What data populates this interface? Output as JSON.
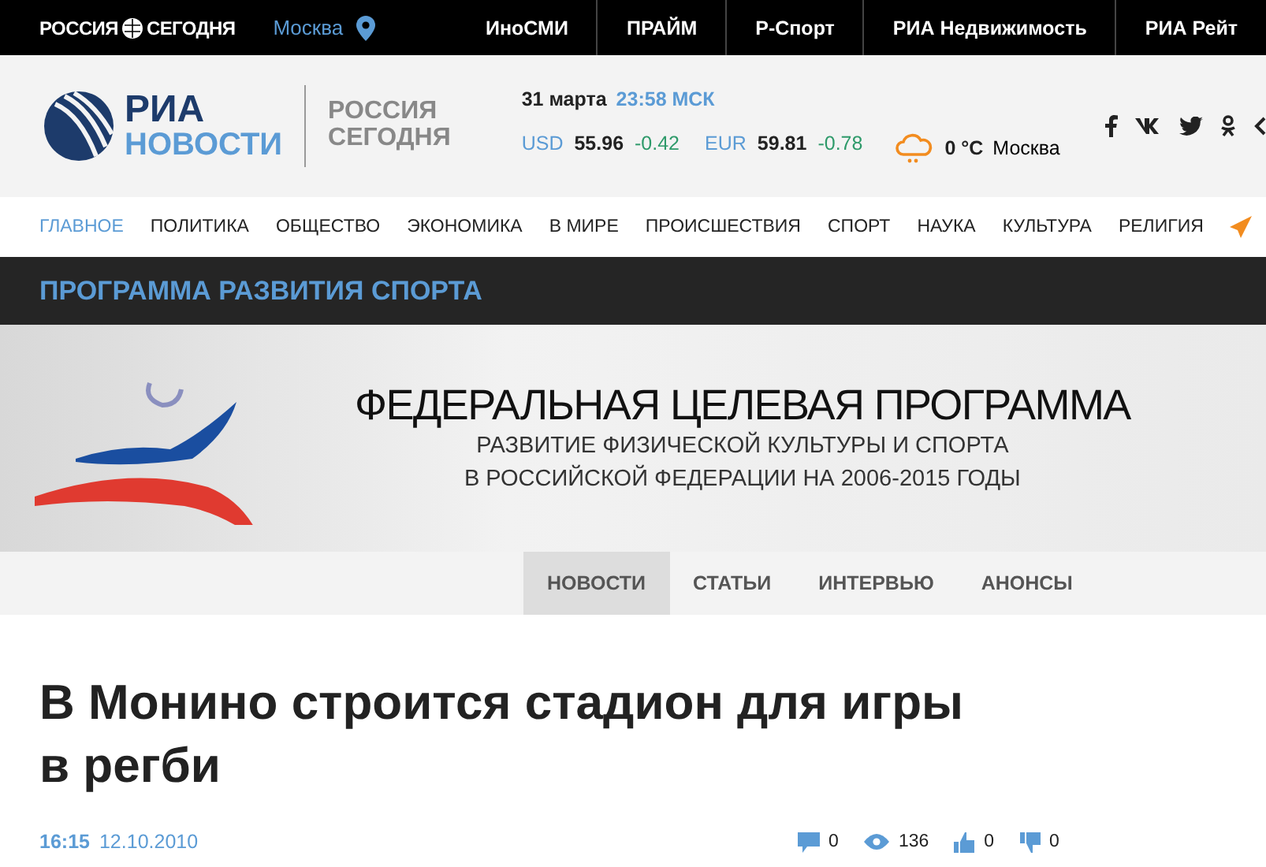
{
  "topbar": {
    "brand_left": "РОССИЯ",
    "brand_right": "СЕГОДНЯ",
    "city": "Москва",
    "links": [
      "ИноСМИ",
      "ПРАЙМ",
      "Р-Спорт",
      "РИА Недвижимость",
      "РИА Рейт"
    ]
  },
  "header": {
    "logo_top": "РИА",
    "logo_bottom": "НОВОСТИ",
    "partner_top": "РОССИЯ",
    "partner_bottom": "СЕГОДНЯ",
    "date": "31 марта",
    "time": "23:58 МСК",
    "rates": [
      {
        "code": "USD",
        "value": "55.96",
        "change": "-0.42"
      },
      {
        "code": "EUR",
        "value": "59.81",
        "change": "-0.78"
      }
    ],
    "weather": {
      "temp": "0 °C",
      "city": "Москва"
    }
  },
  "nav": [
    {
      "label": "ГЛАВНОЕ",
      "selected": true
    },
    {
      "label": "ПОЛИТИКА",
      "selected": false
    },
    {
      "label": "ОБЩЕСТВО",
      "selected": false
    },
    {
      "label": "ЭКОНОМИКА",
      "selected": false
    },
    {
      "label": "В МИРЕ",
      "selected": false
    },
    {
      "label": "ПРОИСШЕСТВИЯ",
      "selected": false
    },
    {
      "label": "СПОРТ",
      "selected": false
    },
    {
      "label": "НАУКА",
      "selected": false
    },
    {
      "label": "КУЛЬТУРА",
      "selected": false
    },
    {
      "label": "РЕЛИГИЯ",
      "selected": false
    }
  ],
  "section_title": "ПРОГРАММА РАЗВИТИЯ СПОРТА",
  "banner": {
    "title": "ФЕДЕРАЛЬНАЯ ЦЕЛЕВАЯ ПРОГРАММА",
    "subtitle_1": "РАЗВИТИЕ ФИЗИЧЕСКОЙ КУЛЬТУРЫ И СПОРТА",
    "subtitle_2": "В РОССИЙСКОЙ ФЕДЕРАЦИИ НА 2006-2015 ГОДЫ"
  },
  "subnav": [
    {
      "label": "НОВОСТИ",
      "selected": true
    },
    {
      "label": "СТАТЬИ",
      "selected": false
    },
    {
      "label": "ИНТЕРВЬЮ",
      "selected": false
    },
    {
      "label": "АНОНСЫ",
      "selected": false
    }
  ],
  "article": {
    "headline": "В Монино строится стадион для игры в регби",
    "time": "16:15",
    "date": "12.10.2010",
    "stats": [
      {
        "kind": "comments",
        "value": "0"
      },
      {
        "kind": "views",
        "value": "136"
      },
      {
        "kind": "likes",
        "value": "0"
      },
      {
        "kind": "dislikes",
        "value": "0"
      }
    ]
  }
}
